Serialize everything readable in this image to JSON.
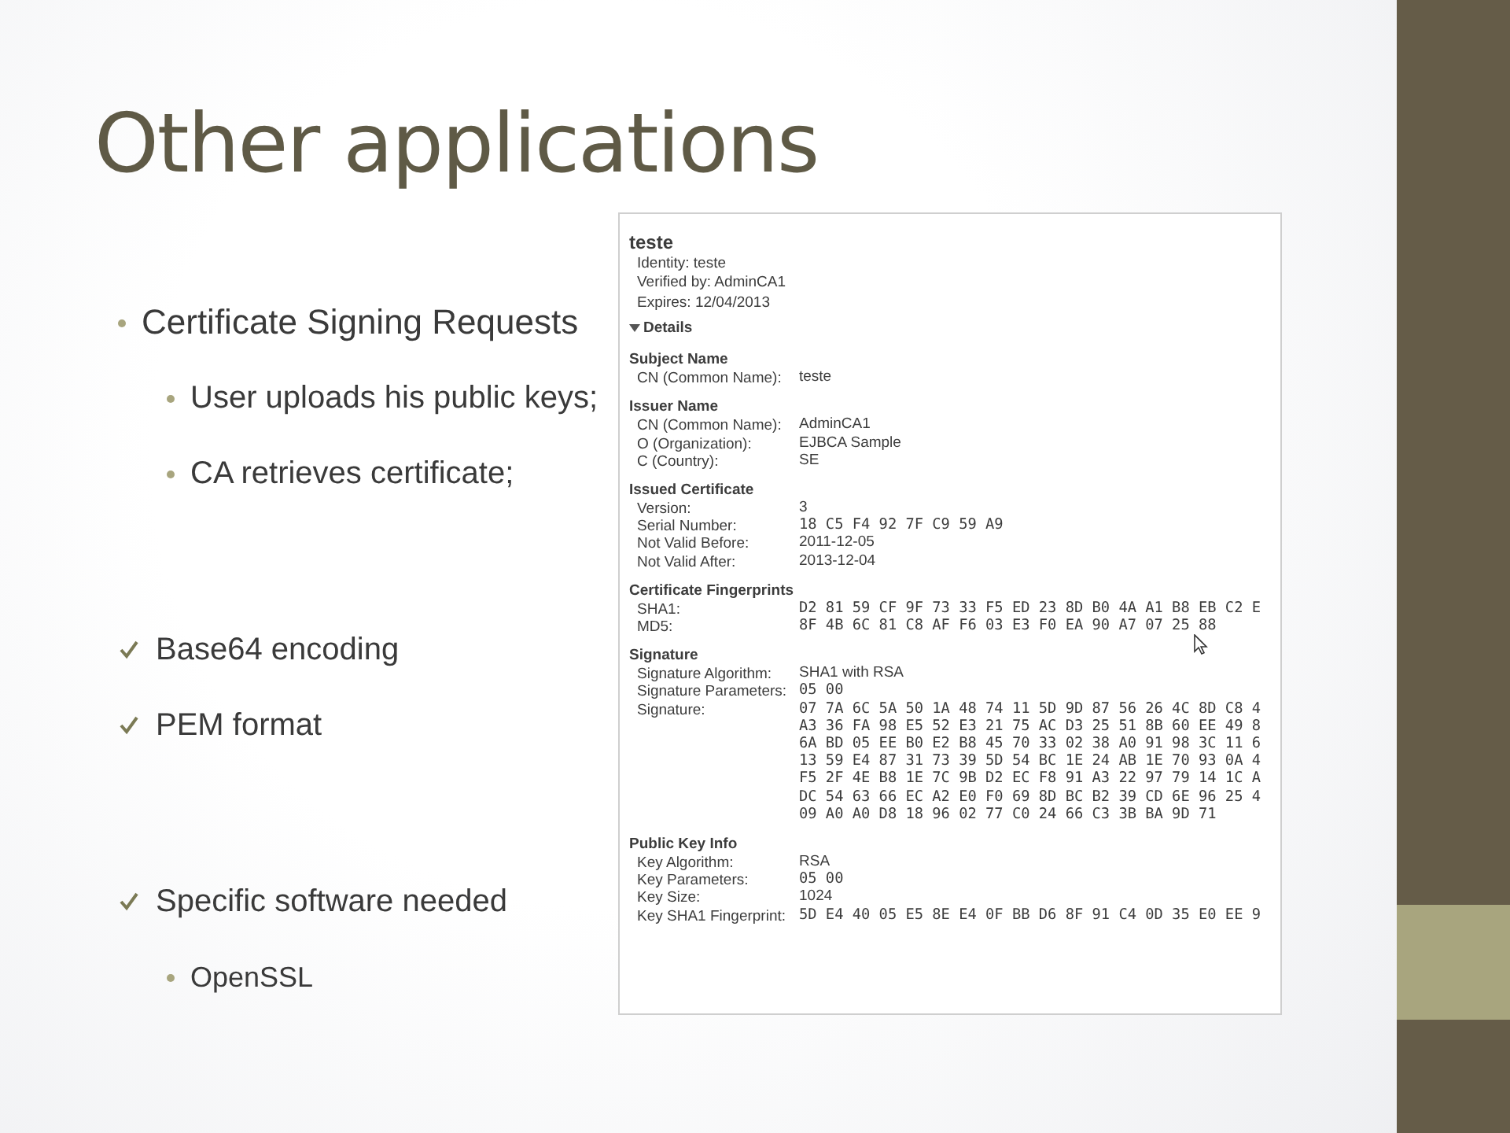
{
  "slide": {
    "title": "Other applications"
  },
  "sections": [
    {
      "items": [
        {
          "kind": "bullet",
          "text": "Certificate Signing Requests"
        },
        {
          "kind": "subbullet",
          "text": "User uploads his public keys;"
        },
        {
          "kind": "subbullet",
          "text": "CA retrieves certificate;"
        }
      ]
    },
    {
      "items": [
        {
          "kind": "check",
          "text": "Base64 encoding"
        },
        {
          "kind": "check",
          "text": "PEM format"
        }
      ]
    },
    {
      "items": [
        {
          "kind": "check",
          "text": "Specific software needed"
        },
        {
          "kind": "subbullet",
          "text": "OpenSSL"
        }
      ]
    }
  ],
  "certificate": {
    "title": "teste",
    "summary": [
      "Identity: teste",
      "Verified by: AdminCA1",
      "Expires: 12/04/2013"
    ],
    "details": {
      "label": "Details",
      "expanded": true
    },
    "sections": [
      {
        "heading": "Subject Name",
        "fields": [
          {
            "kind": "text",
            "label": "CN (Common Name):",
            "value": [
              "teste"
            ]
          }
        ]
      },
      {
        "heading": "Issuer Name",
        "fields": [
          {
            "kind": "text",
            "label": "CN (Common Name):",
            "value": [
              "AdminCA1"
            ]
          },
          {
            "kind": "text",
            "label": "O (Organization):",
            "value": [
              "EJBCA Sample"
            ]
          },
          {
            "kind": "text",
            "label": "C (Country):",
            "value": [
              "SE"
            ]
          }
        ]
      },
      {
        "heading": "Issued Certificate",
        "fields": [
          {
            "kind": "text",
            "label": "Version:",
            "value": [
              "3"
            ]
          },
          {
            "kind": "hex",
            "label": "Serial Number:",
            "value": [
              "18 C5 F4 92 7F C9 59 A9"
            ]
          },
          {
            "kind": "text",
            "label": "Not Valid Before:",
            "value": [
              "2011-12-05"
            ]
          },
          {
            "kind": "text",
            "label": "Not Valid After:",
            "value": [
              "2013-12-04"
            ]
          }
        ]
      },
      {
        "heading": "Certificate Fingerprints",
        "fields": [
          {
            "kind": "hex",
            "label": "SHA1:",
            "value": [
              "D2 81 59 CF 9F 73 33 F5 ED 23 8D B0 4A A1 B8 EB C2 E"
            ]
          },
          {
            "kind": "hex",
            "label": "MD5:",
            "value": [
              "8F 4B 6C 81 C8 AF F6 03 E3 F0 EA 90 A7 07 25 88"
            ]
          }
        ]
      },
      {
        "heading": "Signature",
        "fields": [
          {
            "kind": "text",
            "label": "Signature Algorithm:",
            "value": [
              "SHA1 with RSA"
            ]
          },
          {
            "kind": "hex",
            "label": "Signature Parameters:",
            "value": [
              "05 00"
            ]
          },
          {
            "kind": "hex",
            "label": "Signature:",
            "value": [
              "07 7A 6C 5A 50 1A 48 74 11 5D 9D 87 56 26 4C 8D C8 4",
              "A3 36 FA 98 E5 52 E3 21 75 AC D3 25 51 8B 60 EE 49 8",
              "6A BD 05 EE B0 E2 B8 45 70 33 02 38 A0 91 98 3C 11 6",
              "13 59 E4 87 31 73 39 5D 54 BC 1E 24 AB 1E 70 93 0A 4",
              "F5 2F 4E B8 1E 7C 9B D2 EC F8 91 A3 22 97 79 14 1C A",
              "DC 54 63 66 EC A2 E0 F0 69 8D BC B2 39 CD 6E 96 25 4",
              "09 A0 A0 D8 18 96 02 77 C0 24 66 C3 3B BA 9D 71"
            ]
          }
        ]
      },
      {
        "heading": "Public Key Info",
        "fields": [
          {
            "kind": "text",
            "label": "Key Algorithm:",
            "value": [
              "RSA"
            ]
          },
          {
            "kind": "hex",
            "label": "Key Parameters:",
            "value": [
              "05 00"
            ]
          },
          {
            "kind": "text",
            "label": "Key Size:",
            "value": [
              "1024"
            ]
          },
          {
            "kind": "hex",
            "label": "Key SHA1 Fingerprint:",
            "value": [
              "5D E4 40 05 E5 8E E4 0F BB D6 8F 91 C4 0D 35 E0 EE 9"
            ]
          }
        ]
      }
    ]
  }
}
